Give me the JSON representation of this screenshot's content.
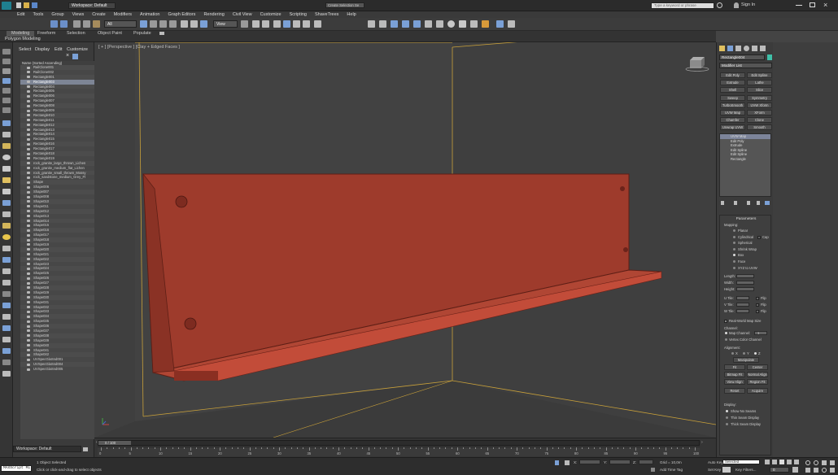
{
  "window": {
    "workspace": "Workspace: Default",
    "search_placeholder": "Type a keyword or phrase",
    "sign_in": "Sign In",
    "selection_set": "Create Selection Se"
  },
  "menu": [
    "Edit",
    "Tools",
    "Group",
    "Views",
    "Create",
    "Modifiers",
    "Animation",
    "Graph Editors",
    "Rendering",
    "Civil View",
    "Customize",
    "Scripting",
    "ShaveTrees",
    "Help"
  ],
  "toolbar": {
    "filter": "All",
    "ref_coord": "View"
  },
  "ribbon": {
    "tabs": [
      "Modeling",
      "Freeform",
      "Selection",
      "Object Paint",
      "Populate"
    ],
    "sub_label": "Polygon Modeling"
  },
  "scene_explorer": {
    "menu": [
      "Select",
      "Display",
      "Edit",
      "Customize"
    ],
    "header": "Name (Sorted Ascending)",
    "items": [
      "RailClone001",
      "RailClone002",
      "Rectangle001",
      "Rectangle003",
      "Rectangle004",
      "Rectangle005",
      "Rectangle006",
      "Rectangle007",
      "Rectangle008",
      "Rectangle009",
      "Rectangle010",
      "Rectangle011",
      "Rectangle012",
      "Rectangle013",
      "Rectangle014",
      "Rectangle015",
      "Rectangle016",
      "Rectangle017",
      "Rectangle018",
      "Rectangle019",
      "rock_granite_large_thrown_Lichen",
      "rock_granite_medium_flat_Lichen",
      "rock_granite_small_thrown_Mossy",
      "rock_sandstone_medium_Grey_Fl",
      "Shape",
      "Shape006",
      "Shape007",
      "Shape008",
      "Shape010",
      "Shape011",
      "Shape012",
      "Shape013",
      "Shape014",
      "Shape015",
      "Shape016",
      "Shape017",
      "Shape018",
      "Shape019",
      "Shape020",
      "Shape021",
      "Shape022",
      "Shape023",
      "Shape024",
      "Shape025",
      "Shape026",
      "Shape027",
      "Shape028",
      "Shape029",
      "Shape030",
      "Shape031",
      "Shape032",
      "Shape033",
      "Shape034",
      "Shape035",
      "Shape036",
      "Shape037",
      "Shape038",
      "Shape039",
      "Shape040",
      "Shape041",
      "Shape042",
      "UVSpecGlaSnd001",
      "UVSpecGlaSnd004",
      "UVSpecGlaSnd005"
    ],
    "selected_index": 3,
    "workspace": "Workspace: Default"
  },
  "viewport": {
    "label": "[ + ] [Perspective ] [Clay + Edged Faces ]",
    "object_color": "#a8402f",
    "bg_color": "#3f3f3f"
  },
  "command_panel": {
    "object_name": "Rectangle004",
    "modifier_list": "Modifier List",
    "buttons": [
      "Edit Poly",
      "Edit Spline",
      "Extrude",
      "Lathe",
      "Shell",
      "Slice",
      "Sweep",
      "Symmetry",
      "TurboSmooth",
      "UVW Xform",
      "UVW Map",
      "XForm",
      "Chamfer",
      "Clone",
      "Unwrap UVW",
      "Smooth"
    ],
    "stack": [
      "UVW Map",
      "Edit Poly",
      "Extrude",
      "Edit Spline",
      "Edit Spline",
      "Rectangle"
    ],
    "stack_highlight": 0,
    "params_title": "Parameters",
    "mapping_label": "Mapping:",
    "mapping_options": [
      "Planar",
      "Cylindrical",
      "Spherical",
      "Shrink Wrap",
      "Box",
      "Face",
      "XYZ to UVW"
    ],
    "mapping_selected": 4,
    "cap_label": "Cap",
    "length_label": "Length:",
    "width_label": "Width:",
    "height_label": "Height:",
    "utile_label": "U Tile:",
    "vtile_label": "V Tile:",
    "wtile_label": "W Tile:",
    "flip_label": "Flip",
    "realworld": "Real-World Map Size",
    "channel_label": "Channel:",
    "map_channel": "Map Channel:",
    "map_channel_value": "1",
    "vertex_color": "Vertex Color Channel",
    "alignment_label": "Alignment:",
    "axes": [
      "X",
      "Y",
      "Z"
    ],
    "align_buttons": [
      "Manipulate",
      "Fit",
      "Center",
      "Bitmap Fit",
      "Normal Align",
      "View Align",
      "Region Fit",
      "Reset",
      "Acquire"
    ],
    "display_label": "Display:",
    "display_options": [
      "Show No Seams",
      "Thin Seam Display",
      "Thick Seam Display"
    ]
  },
  "timeline": {
    "frame_counter": "0 / 100",
    "ticks": [
      "0",
      "5",
      "10",
      "15",
      "20",
      "25",
      "30",
      "35",
      "40",
      "45",
      "50",
      "55",
      "60",
      "65",
      "70",
      "75",
      "80",
      "85",
      "90",
      "95",
      "100"
    ]
  },
  "status": {
    "maxscript": "MAXScript Mi",
    "selected": "1 Object Selected",
    "prompt": "Click or click-and-drag to select objects",
    "x_label": "X:",
    "y_label": "Y:",
    "z_label": "Z:",
    "grid": "Grid = 10,0m",
    "add_time_tag": "Add Time Tag",
    "auto_key": "Auto Key",
    "set_key": "Set Key",
    "selected_dd": "Selected",
    "key_filters": "Key Filters...",
    "frame": "0"
  }
}
